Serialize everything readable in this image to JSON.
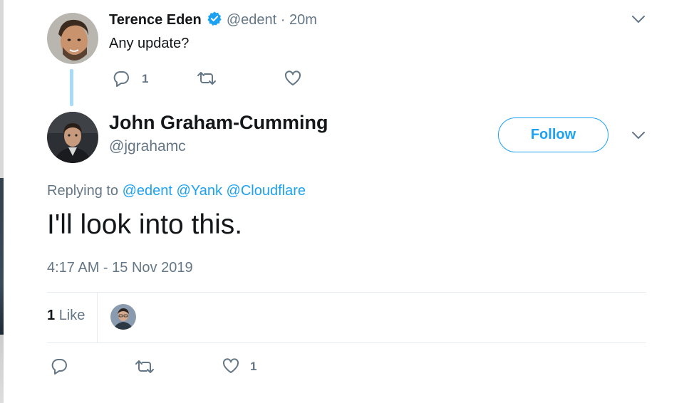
{
  "parent_tweet": {
    "author_name": "Terence Eden",
    "handle": "@edent",
    "separator": " · ",
    "time_ago": "20m",
    "text": "Any update?",
    "reply_count": "1",
    "verified": true
  },
  "main_tweet": {
    "author_name": "John Graham-Cumming",
    "handle": "@jgrahamc",
    "follow_label": "Follow",
    "replying_to_label": "Replying to",
    "replying_to": [
      "@edent",
      "@Yank",
      "@Cloudflare"
    ],
    "text": "I'll look into this.",
    "timestamp": "4:17 AM - 15 Nov 2019",
    "likes_count": "1",
    "likes_label": "Like",
    "action_like_count": "1"
  },
  "colors": {
    "accent": "#1da1f2",
    "muted": "#657786",
    "text": "#14171a",
    "thread_line": "#a6dcf7"
  },
  "icons": [
    "verified-badge-icon",
    "chevron-down-icon",
    "reply-icon",
    "retweet-icon",
    "like-icon"
  ]
}
